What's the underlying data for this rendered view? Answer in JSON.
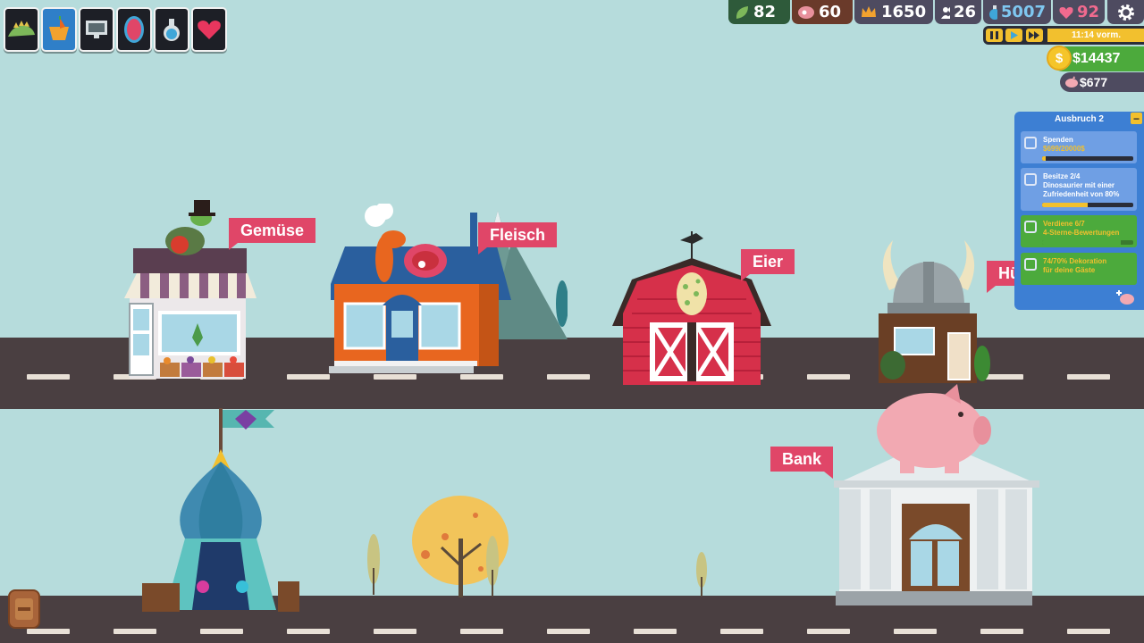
{
  "toolbar": [
    {
      "name": "dino-terrain",
      "icon": "stegosaurus-icon"
    },
    {
      "name": "shop",
      "icon": "basket-icon"
    },
    {
      "name": "computer",
      "icon": "monitor-icon"
    },
    {
      "name": "egg",
      "icon": "egg-icon"
    },
    {
      "name": "potion",
      "icon": "flask-icon"
    },
    {
      "name": "health",
      "icon": "heart-icon"
    }
  ],
  "resources": {
    "herb": "82",
    "meat": "60",
    "rating": "1650",
    "guests": "26",
    "potion": "5007",
    "happiness": "92"
  },
  "clock": {
    "time": "11:14 vorm."
  },
  "money": {
    "cash": "$14437",
    "savings": "$677"
  },
  "quests": {
    "title": "Ausbruch 2",
    "items": [
      {
        "line1": "Spenden",
        "line2": "$699/20000$",
        "progress": 0.035,
        "checked": false
      },
      {
        "line1": "Besitze 2/4",
        "line2": "Dinosaurier mit einer Zufriedenheit von 80%",
        "progress": 0.5,
        "checked": true
      },
      {
        "line1": "Verdiene 6/7",
        "line2": "4-Sterne-Bewertungen",
        "progress": 0.86,
        "checked": true
      },
      {
        "line1": "74/70% Dekoration",
        "line2": "für deine Gäste",
        "progress": 1.0,
        "checked": true
      }
    ]
  },
  "buildings": {
    "vegetables": "Gemüse",
    "meat": "Fleisch",
    "eggs": "Eier",
    "hut": "Hü",
    "bank": "Bank"
  },
  "colors": {
    "sky": "#b6dcdc",
    "road": "#4a3f41",
    "tag": "#e04668",
    "quest_panel": "#3d7fd3",
    "quest_done": "#4caa3c",
    "accent": "#f2c02e"
  }
}
